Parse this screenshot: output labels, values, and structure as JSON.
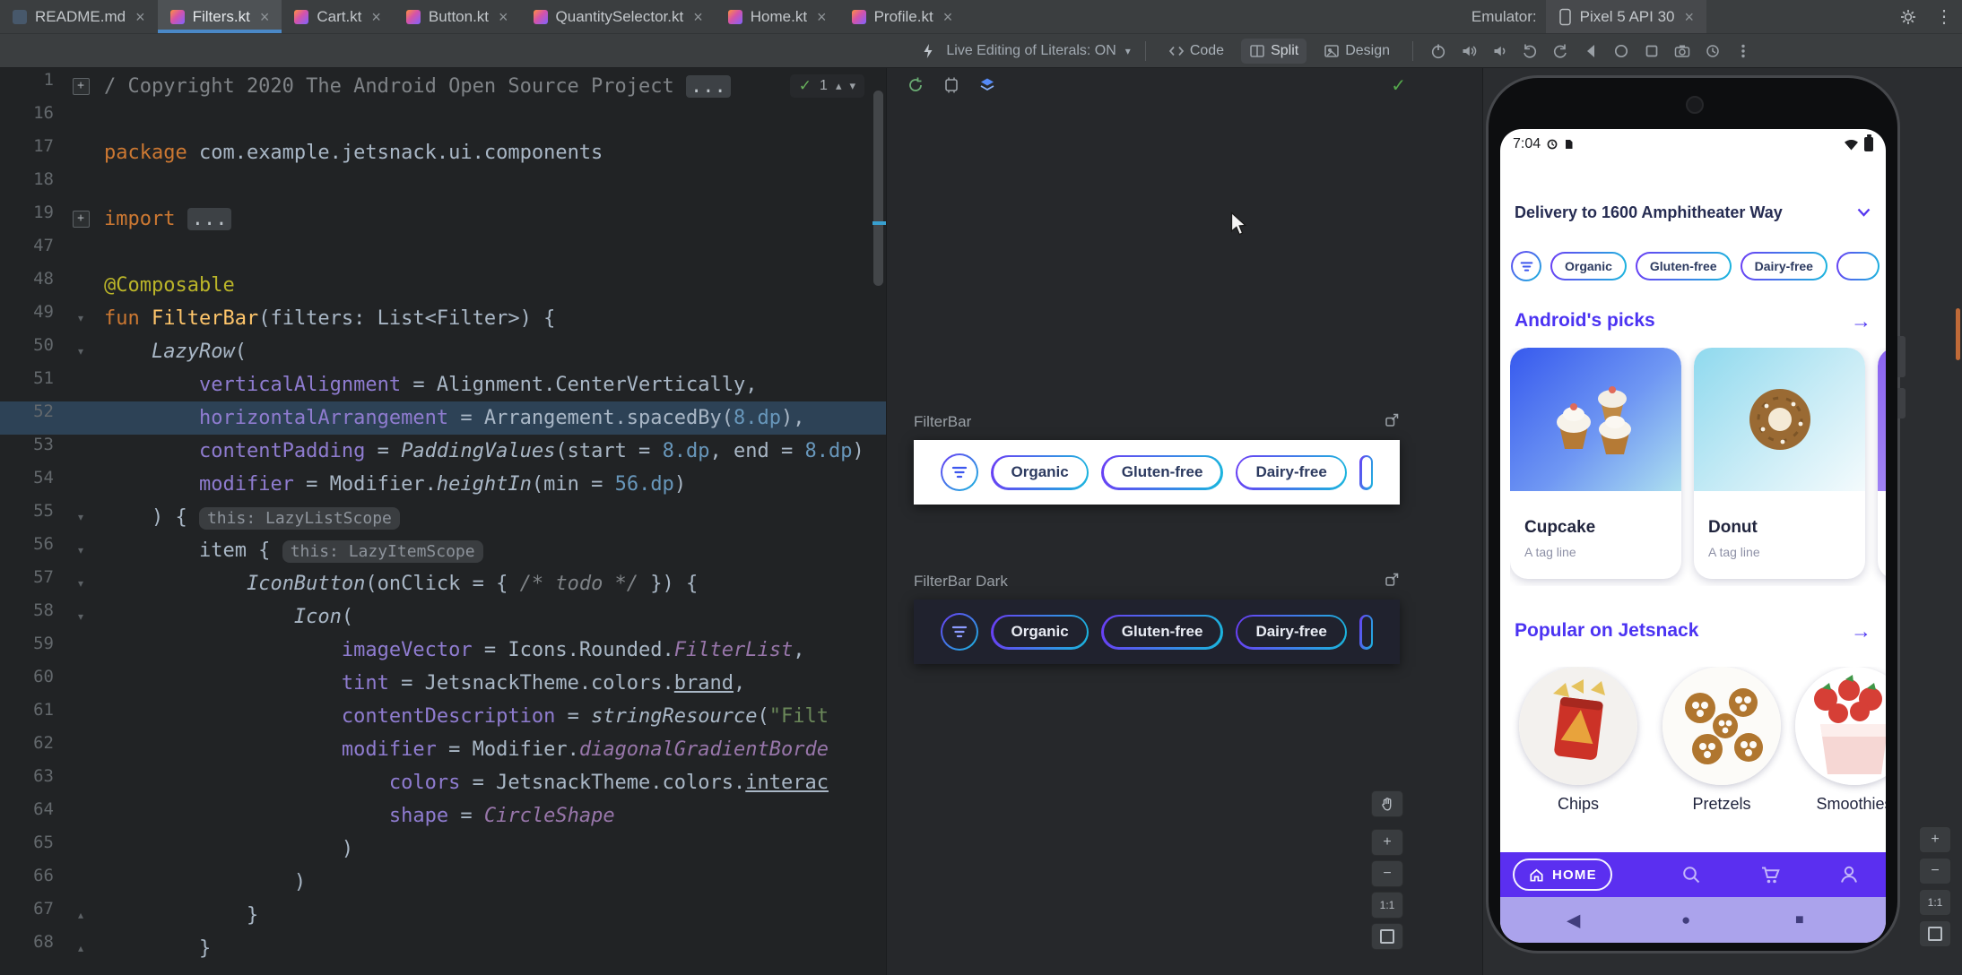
{
  "tabbar": {
    "tabs": [
      {
        "label": "README.md",
        "icon": "md"
      },
      {
        "label": "Filters.kt",
        "icon": "kt",
        "active": true
      },
      {
        "label": "Cart.kt",
        "icon": "kt"
      },
      {
        "label": "Button.kt",
        "icon": "kt"
      },
      {
        "label": "QuantitySelector.kt",
        "icon": "kt"
      },
      {
        "label": "Home.kt",
        "icon": "kt"
      },
      {
        "label": "Profile.kt",
        "icon": "kt"
      }
    ],
    "close_glyph": "×",
    "emulator_label": "Emulator:",
    "emulator_tab": "Pixel 5 API 30"
  },
  "toolbar": {
    "live_literals": "Live Editing of Literals: ON",
    "code": "Code",
    "split": "Split",
    "design": "Design"
  },
  "editor": {
    "inspection_count": "1",
    "lines": [
      {
        "n": "1",
        "fold": true,
        "segs": [
          [
            "c",
            "/ Copyright 2020 The Android Open Source Project "
          ],
          [
            "fb",
            "..."
          ]
        ]
      },
      {
        "n": "16",
        "segs": []
      },
      {
        "n": "17",
        "segs": [
          [
            "k",
            "package"
          ],
          [
            "d",
            " com.example.jetsnack.ui.components"
          ]
        ]
      },
      {
        "n": "18",
        "segs": []
      },
      {
        "n": "19",
        "fold": true,
        "segs": [
          [
            "k",
            "import"
          ],
          [
            "d",
            " "
          ],
          [
            "fb",
            "..."
          ]
        ]
      },
      {
        "n": "47",
        "segs": []
      },
      {
        "n": "48",
        "segs": [
          [
            "a",
            "@Composable"
          ]
        ]
      },
      {
        "n": "49",
        "g": 1,
        "segs": [
          [
            "k",
            "fun "
          ],
          [
            "f",
            "FilterBar"
          ],
          [
            "d",
            "(filters: List<Filter>) {"
          ]
        ]
      },
      {
        "n": "50",
        "g": 1,
        "segs": [
          [
            "d",
            "    "
          ],
          [
            "i",
            "LazyRow"
          ],
          [
            "d",
            "("
          ]
        ]
      },
      {
        "n": "51",
        "segs": [
          [
            "d",
            "        "
          ],
          [
            "nm",
            "verticalAlignment"
          ],
          [
            "d",
            " = Alignment.CenterVertically,"
          ]
        ]
      },
      {
        "n": "52",
        "hl": true,
        "segs": [
          [
            "d",
            "        "
          ],
          [
            "nm",
            "horizontalArrangement"
          ],
          [
            "d",
            " = Arrangement.spacedBy("
          ],
          [
            "m",
            "8.dp"
          ],
          [
            "d",
            "),"
          ]
        ]
      },
      {
        "n": "53",
        "segs": [
          [
            "d",
            "        "
          ],
          [
            "nm",
            "contentPadding"
          ],
          [
            "d",
            " = "
          ],
          [
            "i",
            "PaddingValues"
          ],
          [
            "d",
            "(start = "
          ],
          [
            "m",
            "8.dp"
          ],
          [
            "d",
            ", end = "
          ],
          [
            "m",
            "8.dp"
          ],
          [
            "d",
            ")"
          ]
        ]
      },
      {
        "n": "54",
        "segs": [
          [
            "d",
            "        "
          ],
          [
            "nm",
            "modifier"
          ],
          [
            "d",
            " = Modifier."
          ],
          [
            "i",
            "heightIn"
          ],
          [
            "d",
            "(min = "
          ],
          [
            "m",
            "56.dp"
          ],
          [
            "d",
            ")"
          ]
        ]
      },
      {
        "n": "55",
        "g": 1,
        "segs": [
          [
            "d",
            "    ) { "
          ],
          [
            "h",
            "this: LazyListScope"
          ]
        ]
      },
      {
        "n": "56",
        "g": 1,
        "segs": [
          [
            "d",
            "        item { "
          ],
          [
            "h",
            "this: LazyItemScope"
          ]
        ]
      },
      {
        "n": "57",
        "g": 1,
        "segs": [
          [
            "d",
            "            "
          ],
          [
            "i",
            "IconButton"
          ],
          [
            "d",
            "(onClick = { "
          ],
          [
            "ci",
            "/* todo */"
          ],
          [
            "d",
            " }) {"
          ]
        ]
      },
      {
        "n": "58",
        "g": 1,
        "segs": [
          [
            "d",
            "                "
          ],
          [
            "i",
            "Icon"
          ],
          [
            "d",
            "("
          ]
        ]
      },
      {
        "n": "59",
        "segs": [
          [
            "d",
            "                    "
          ],
          [
            "nm",
            "imageVector"
          ],
          [
            "d",
            " = Icons.Rounded."
          ],
          [
            "p",
            "FilterList"
          ],
          [
            "d",
            ","
          ]
        ]
      },
      {
        "n": "60",
        "segs": [
          [
            "d",
            "                    "
          ],
          [
            "nm",
            "tint"
          ],
          [
            "d",
            " = JetsnackTheme.colors."
          ],
          [
            "u",
            "brand"
          ],
          [
            "d",
            ","
          ]
        ]
      },
      {
        "n": "61",
        "segs": [
          [
            "d",
            "                    "
          ],
          [
            "nm",
            "contentDescription"
          ],
          [
            "d",
            " = "
          ],
          [
            "i",
            "stringResource"
          ],
          [
            "d",
            "("
          ],
          [
            "s",
            "\"Filt"
          ]
        ]
      },
      {
        "n": "62",
        "segs": [
          [
            "d",
            "                    "
          ],
          [
            "nm",
            "modifier"
          ],
          [
            "d",
            " = Modifier."
          ],
          [
            "p",
            "diagonalGradientBorde"
          ]
        ]
      },
      {
        "n": "63",
        "segs": [
          [
            "d",
            "                        "
          ],
          [
            "nm",
            "colors"
          ],
          [
            "d",
            " = JetsnackTheme.colors."
          ],
          [
            "u",
            "interac"
          ]
        ]
      },
      {
        "n": "64",
        "segs": [
          [
            "d",
            "                        "
          ],
          [
            "nm",
            "shape"
          ],
          [
            "d",
            " = "
          ],
          [
            "p",
            "CircleShape"
          ]
        ]
      },
      {
        "n": "65",
        "segs": [
          [
            "d",
            "                    )"
          ]
        ]
      },
      {
        "n": "66",
        "segs": [
          [
            "d",
            "                )"
          ]
        ]
      },
      {
        "n": "67",
        "g": 2,
        "segs": [
          [
            "d",
            "            }"
          ]
        ]
      },
      {
        "n": "68",
        "g": 2,
        "segs": [
          [
            "d",
            "        }"
          ]
        ]
      }
    ]
  },
  "preview": {
    "groups": [
      {
        "label": "FilterBar",
        "theme": "light",
        "chips": [
          "Organic",
          "Gluten-free",
          "Dairy-free"
        ]
      },
      {
        "label": "FilterBar Dark",
        "theme": "dark",
        "chips": [
          "Organic",
          "Gluten-free",
          "Dairy-free"
        ]
      }
    ],
    "zoom_100": "1:1"
  },
  "emulator": {
    "time": "7:04",
    "delivery": "Delivery to 1600 Amphitheater Way",
    "chips": [
      "Organic",
      "Gluten-free",
      "Dairy-free"
    ],
    "picks": {
      "title": "Android's picks",
      "arrow": "→",
      "cards": [
        {
          "name": "Cupcake",
          "tag": "A tag line"
        },
        {
          "name": "Donut",
          "tag": "A tag line"
        }
      ]
    },
    "popular": {
      "title": "Popular on Jetsnack",
      "arrow": "→",
      "items": [
        "Chips",
        "Pretzels",
        "Smoothies"
      ]
    },
    "nav_home": "HOME",
    "zoom_100": "1:1"
  },
  "glyphs": {
    "close": "×",
    "check": "✓",
    "up": "▴",
    "down": "▾",
    "plus": "+",
    "minus": "−",
    "back": "◀",
    "circle": "●",
    "square": "■",
    "kebab": "⋮",
    "arrow": "→"
  }
}
